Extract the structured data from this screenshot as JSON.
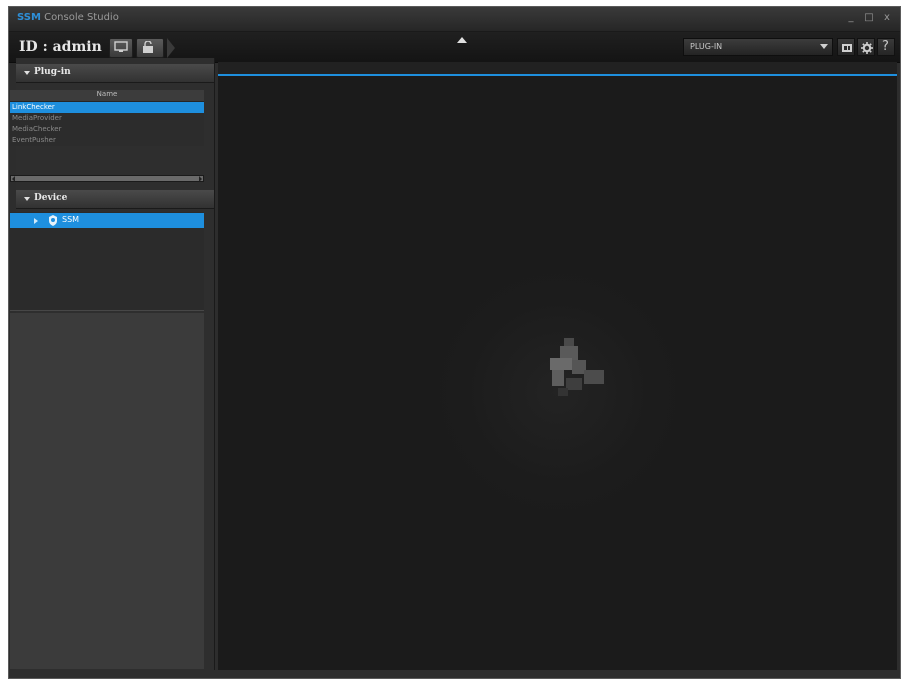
{
  "window": {
    "title_brand": "SSM",
    "title_rest": " Console Studio",
    "controls": [
      "_",
      "□",
      "x"
    ]
  },
  "toolbar": {
    "user_id": "ID : admin",
    "plugin_select": {
      "selected": "PLUG-IN"
    },
    "help_label": "?"
  },
  "sidebar": {
    "plugin_section": {
      "label": "Plug-in"
    },
    "plugin_table": {
      "column": "Name",
      "rows": [
        "LinkChecker",
        "MediaProvider",
        "MediaChecker",
        "EventPusher"
      ],
      "selected_index": 0
    },
    "device_section": {
      "label": "Device"
    },
    "device_tree": {
      "label": "SSM"
    }
  },
  "colors": {
    "accent": "#1e8fde",
    "brand": "#2e8fd8",
    "background": "#2d2d2d",
    "main_area": "#1b1b1b"
  },
  "icons": [
    "monitor-icon",
    "lock-icon",
    "collapse-arrow-icon",
    "layout-icon",
    "gear-icon",
    "help-icon",
    "device-icon",
    "plugin-graphic"
  ]
}
